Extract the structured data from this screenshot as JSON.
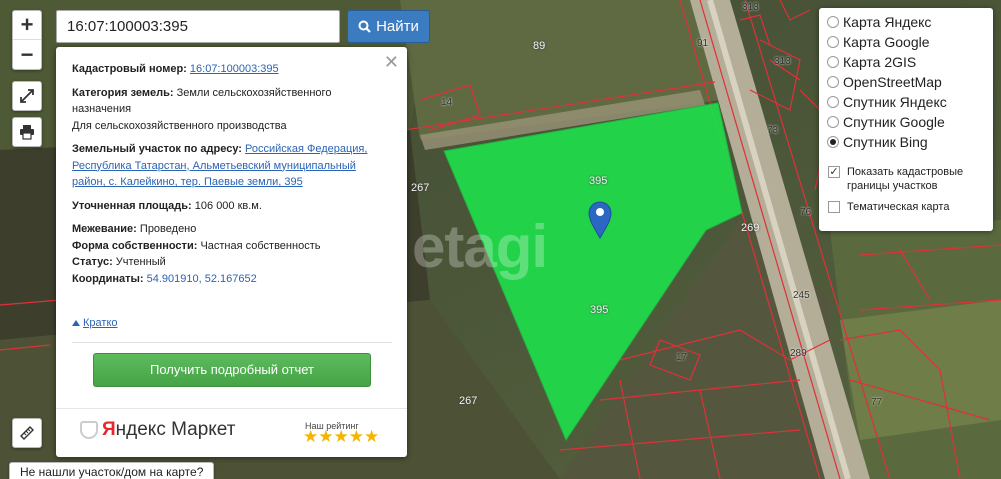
{
  "search": {
    "value": "16:07:100003:395",
    "button_label": "Найти"
  },
  "zoom": {
    "in_label": "+",
    "out_label": "−"
  },
  "map": {
    "watermark": "etagi",
    "plot_labels": [
      "89",
      "14",
      "267",
      "395",
      "395",
      "269",
      "17",
      "267",
      "91",
      "313",
      "313",
      "73",
      "76",
      "245",
      "289",
      "77"
    ]
  },
  "popup": {
    "cadastral_label": "Кадастровый номер:",
    "cadastral_value": "16:07:100003:395",
    "category_label": "Категория земель:",
    "category_value": "Земли сельскохозяйственного назначения",
    "category_use": "Для сельскохозяйственного производства",
    "address_label": "Земельный участок по адресу:",
    "address_value": "Российская Федерация, Республика Татарстан, Альметьевский муниципальный район, с. Калейкино, тер. Паевые земли, 395",
    "area_label": "Уточненная площадь:",
    "area_value": "106 000 кв.м.",
    "survey_label": "Межевание:",
    "survey_value": "Проведено",
    "ownership_label": "Форма собственности:",
    "ownership_value": "Частная собственность",
    "status_label": "Статус:",
    "status_value": "Учтенный",
    "coords_label": "Координаты:",
    "coords_value": "54.901910, 52.167652",
    "collapse_label": "Кратко",
    "report_button": "Получить подробный отчет",
    "market_logo_y": "Я",
    "market_logo_text": "ндекс Маркет",
    "rating_label": "Наш рейтинг",
    "stars": "★★★★★",
    "close": "✕"
  },
  "bottom_note": "Не нашли участок/дом на карте?",
  "layers": {
    "items": [
      {
        "label": "Карта Яндекс",
        "selected": false
      },
      {
        "label": "Карта Google",
        "selected": false
      },
      {
        "label": "Карта 2GIS",
        "selected": false
      },
      {
        "label": "OpenStreetMap",
        "selected": false
      },
      {
        "label": "Спутник Яндекс",
        "selected": false
      },
      {
        "label": "Спутник Google",
        "selected": false
      },
      {
        "label": "Спутник Bing",
        "selected": true
      }
    ],
    "show_borders": "Показать кадастровые границы участков",
    "show_borders_checked": true,
    "thematic": "Тематическая карта",
    "thematic_checked": false
  }
}
